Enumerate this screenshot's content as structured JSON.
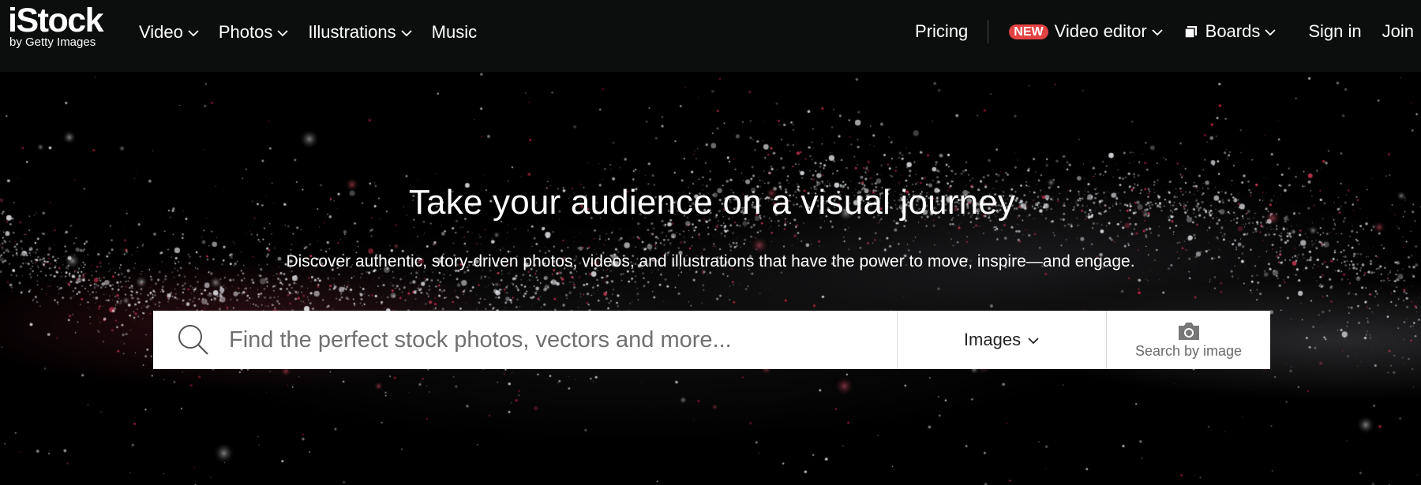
{
  "brand": {
    "logo_main": "iStock",
    "logo_sub": "by Getty Images"
  },
  "nav_left": [
    {
      "label": "Video",
      "has_dropdown": true
    },
    {
      "label": "Photos",
      "has_dropdown": true
    },
    {
      "label": "Illustrations",
      "has_dropdown": true
    },
    {
      "label": "Music",
      "has_dropdown": false
    }
  ],
  "nav_right": {
    "pricing": "Pricing",
    "new_badge": "NEW",
    "video_editor": "Video editor",
    "boards": "Boards",
    "sign_in": "Sign in",
    "join": "Join"
  },
  "hero": {
    "headline": "Take your audience on a visual journey",
    "subline": "Discover authentic, story-driven photos, videos, and illustrations that have the power to move, inspire—and engage."
  },
  "search": {
    "placeholder": "Find the perfect stock photos, vectors and more...",
    "value": "",
    "type_selected": "Images",
    "search_by_image": "Search by image"
  },
  "icons": {
    "search": "search-icon",
    "chevron": "chevron-down-icon",
    "camera": "camera-icon",
    "boards": "boards-icon"
  },
  "colors": {
    "topbar_bg": "#0c0d0d",
    "new_badge": "#e34242",
    "hero_bg": "#000000",
    "search_bg": "#ffffff"
  }
}
